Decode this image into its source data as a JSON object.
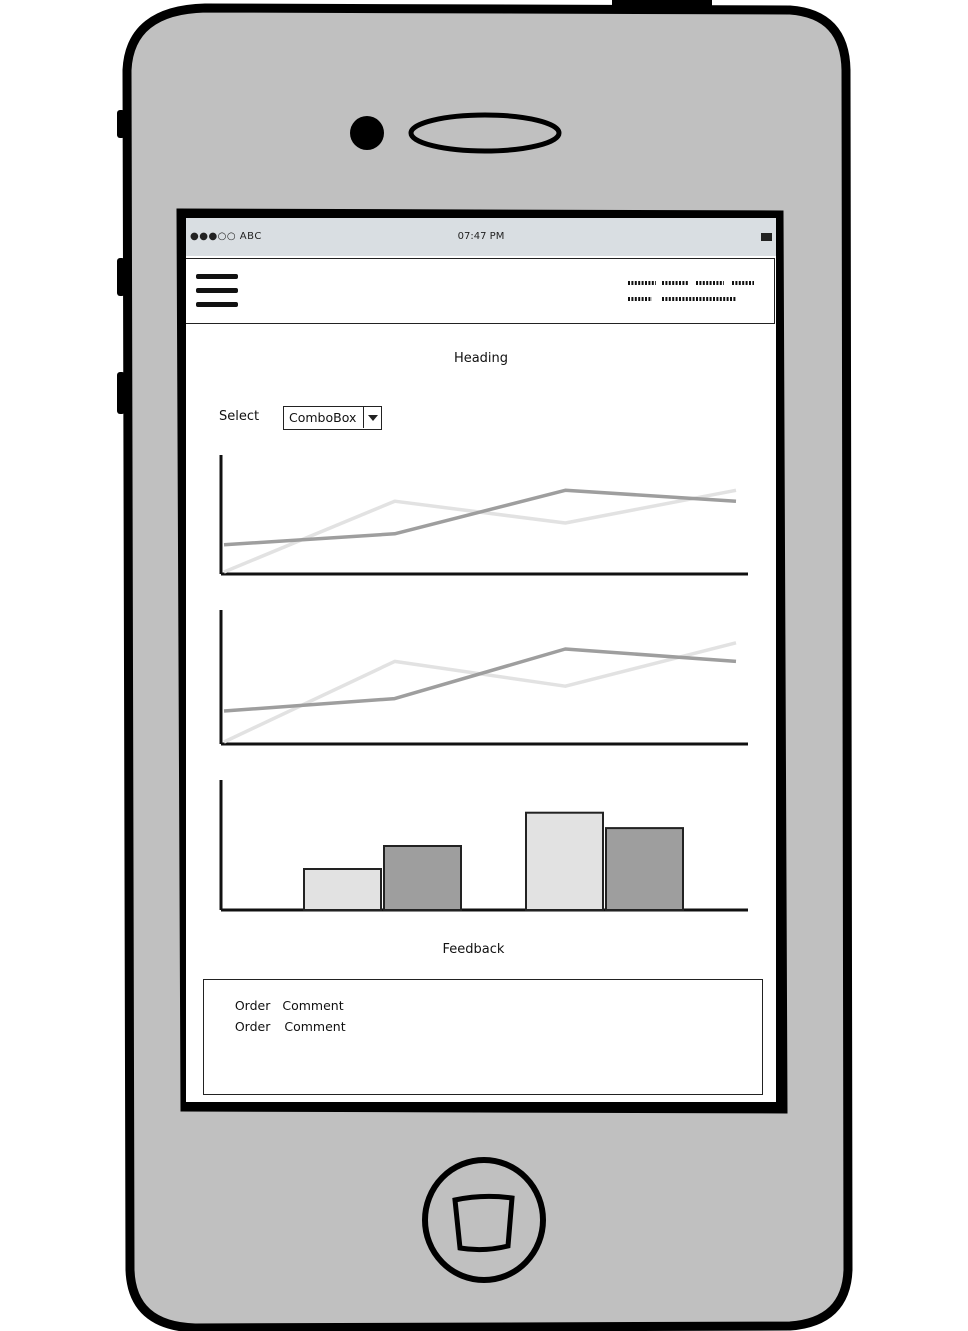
{
  "status_bar": {
    "carrier": "●●●○○ ABC",
    "time": "07:47 PM"
  },
  "nav": {
    "menu_icon": "hamburger-menu-icon",
    "scribble_text": "placeholder-scribble"
  },
  "main": {
    "heading": "Heading",
    "select_label": "Select",
    "combobox_value": "ComboBox"
  },
  "charts": {
    "colors": {
      "light": "#e2e2e2",
      "dark": "#9e9e9e",
      "axis": "#111111"
    }
  },
  "chart_data": [
    {
      "type": "line",
      "x": [
        0,
        1,
        2,
        3
      ],
      "series": [
        {
          "values": [
            0,
            6.5,
            4.5,
            7.5
          ]
        },
        {
          "values": [
            2.5,
            3.5,
            7.5,
            6.5
          ]
        }
      ],
      "ylim": [
        0,
        10
      ]
    },
    {
      "type": "line",
      "x": [
        0,
        1,
        2,
        3
      ],
      "series": [
        {
          "values": [
            0,
            6.5,
            4.5,
            8
          ]
        },
        {
          "values": [
            2.5,
            3.5,
            7.5,
            6.5
          ]
        }
      ],
      "ylim": [
        0,
        10
      ]
    },
    {
      "type": "bar",
      "categories": [
        "",
        ""
      ],
      "series": [
        {
          "values": [
            3.2,
            5
          ]
        },
        {
          "values": [
            7.6,
            6.4
          ]
        }
      ],
      "ylim": [
        0,
        10
      ]
    }
  ],
  "feedback": {
    "title": "Feedback",
    "rows": [
      {
        "order": "Order",
        "comment": "Comment"
      },
      {
        "order": "Order",
        "comment": "Comment"
      }
    ]
  }
}
